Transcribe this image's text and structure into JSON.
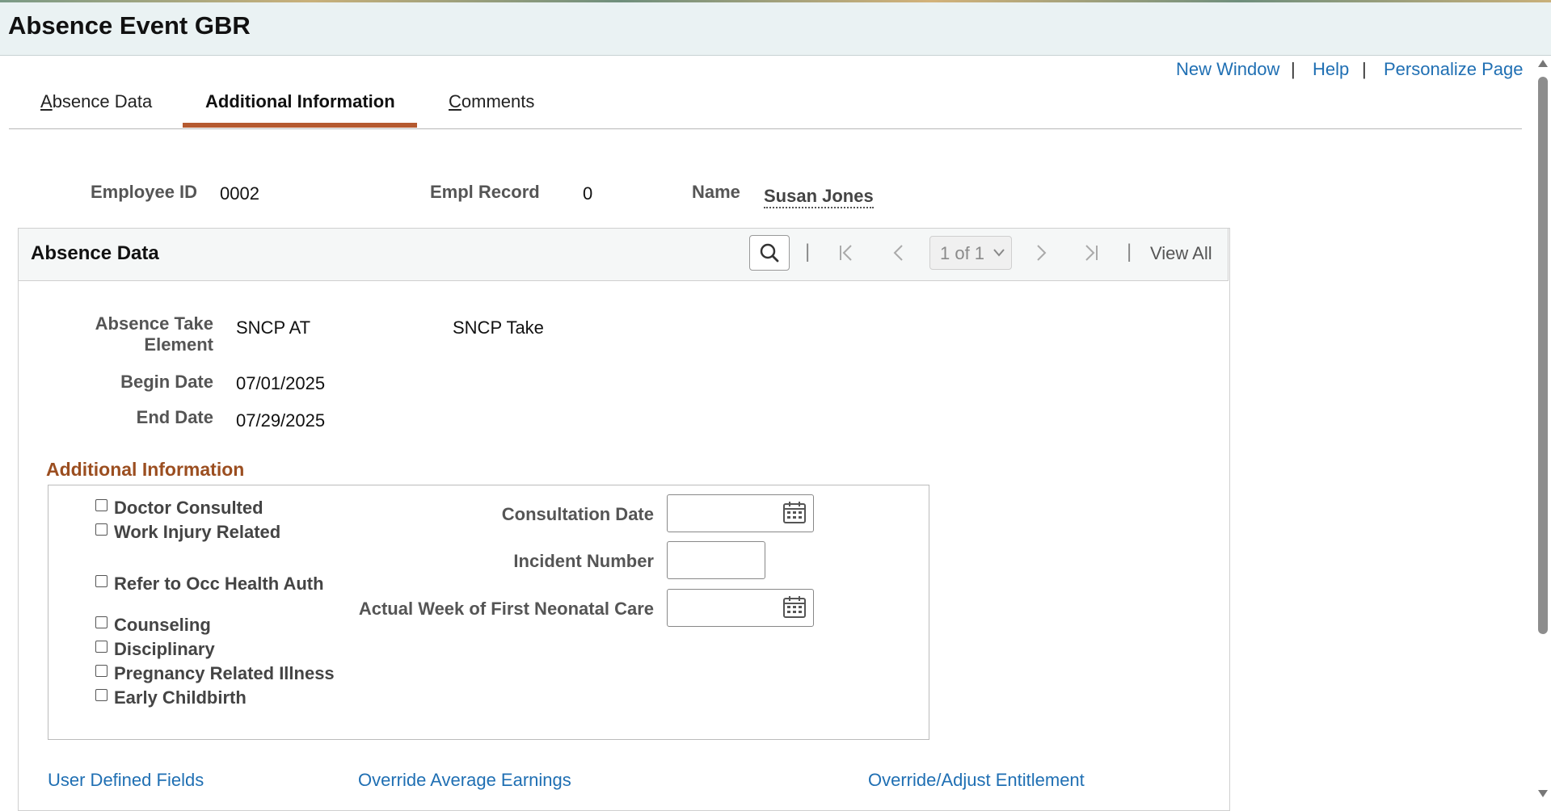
{
  "window": {
    "title": "Absence Event GBR"
  },
  "toplinks": {
    "new_window": "New Window",
    "help": "Help",
    "personalize": "Personalize Page",
    "sep": "|"
  },
  "tabs": [
    {
      "label_first": "A",
      "label_rest": "bsence Data"
    },
    {
      "label": "Additional Information"
    },
    {
      "label_first": "C",
      "label_rest": "omments"
    }
  ],
  "header": {
    "employee_id_label": "Employee ID",
    "employee_id": "0002",
    "empl_record_label": "Empl Record",
    "empl_record": "0",
    "name_label": "Name",
    "name": "Susan Jones"
  },
  "panel": {
    "title": "Absence Data",
    "pager": "1 of 1",
    "view_all": "View All",
    "sep": "|",
    "absence_take_label_1": "Absence Take",
    "absence_take_label_2": "Element",
    "absence_take_code": "SNCP AT",
    "absence_take_desc": "SNCP Take",
    "begin_date_label": "Begin Date",
    "begin_date": "07/01/2025",
    "end_date_label": "End Date",
    "end_date": "07/29/2025"
  },
  "additional": {
    "title": "Additional Information",
    "checkboxes": {
      "doctor": "Doctor Consulted",
      "work_injury": "Work Injury Related",
      "occ_health": "Refer to Occ Health Auth",
      "counseling": "Counseling",
      "disciplinary": "Disciplinary",
      "pregnancy": "Pregnancy Related Illness",
      "childbirth": "Early Childbirth"
    },
    "consultation_date_label": "Consultation Date",
    "consultation_date": "",
    "incident_number_label": "Incident Number",
    "incident_number": "",
    "neonatal_label": "Actual Week of First Neonatal Care",
    "neonatal_date": ""
  },
  "bottom_links": {
    "user_defined": "User Defined Fields",
    "override_avg": "Override Average Earnings",
    "override_adjust": "Override/Adjust Entitlement"
  },
  "colors": {
    "link": "#1f6fb3",
    "accent": "#b55a30",
    "section_title": "#9b4e20"
  }
}
